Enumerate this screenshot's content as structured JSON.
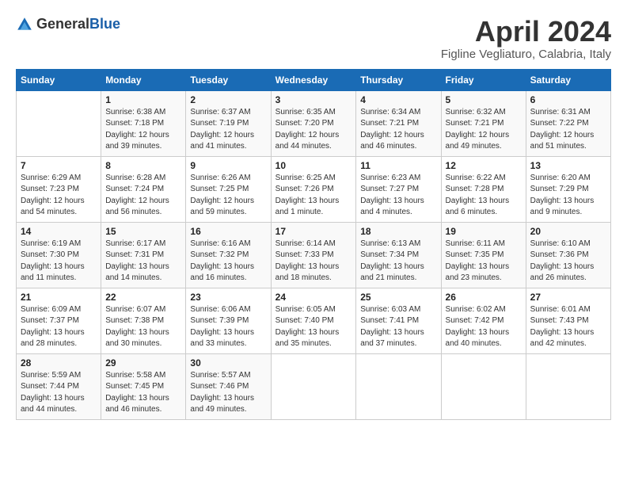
{
  "header": {
    "logo_general": "General",
    "logo_blue": "Blue",
    "title": "April 2024",
    "location": "Figline Vegliaturo, Calabria, Italy"
  },
  "columns": [
    "Sunday",
    "Monday",
    "Tuesday",
    "Wednesday",
    "Thursday",
    "Friday",
    "Saturday"
  ],
  "weeks": [
    [
      {
        "num": "",
        "detail": ""
      },
      {
        "num": "1",
        "detail": "Sunrise: 6:38 AM\nSunset: 7:18 PM\nDaylight: 12 hours\nand 39 minutes."
      },
      {
        "num": "2",
        "detail": "Sunrise: 6:37 AM\nSunset: 7:19 PM\nDaylight: 12 hours\nand 41 minutes."
      },
      {
        "num": "3",
        "detail": "Sunrise: 6:35 AM\nSunset: 7:20 PM\nDaylight: 12 hours\nand 44 minutes."
      },
      {
        "num": "4",
        "detail": "Sunrise: 6:34 AM\nSunset: 7:21 PM\nDaylight: 12 hours\nand 46 minutes."
      },
      {
        "num": "5",
        "detail": "Sunrise: 6:32 AM\nSunset: 7:21 PM\nDaylight: 12 hours\nand 49 minutes."
      },
      {
        "num": "6",
        "detail": "Sunrise: 6:31 AM\nSunset: 7:22 PM\nDaylight: 12 hours\nand 51 minutes."
      }
    ],
    [
      {
        "num": "7",
        "detail": "Sunrise: 6:29 AM\nSunset: 7:23 PM\nDaylight: 12 hours\nand 54 minutes."
      },
      {
        "num": "8",
        "detail": "Sunrise: 6:28 AM\nSunset: 7:24 PM\nDaylight: 12 hours\nand 56 minutes."
      },
      {
        "num": "9",
        "detail": "Sunrise: 6:26 AM\nSunset: 7:25 PM\nDaylight: 12 hours\nand 59 minutes."
      },
      {
        "num": "10",
        "detail": "Sunrise: 6:25 AM\nSunset: 7:26 PM\nDaylight: 13 hours\nand 1 minute."
      },
      {
        "num": "11",
        "detail": "Sunrise: 6:23 AM\nSunset: 7:27 PM\nDaylight: 13 hours\nand 4 minutes."
      },
      {
        "num": "12",
        "detail": "Sunrise: 6:22 AM\nSunset: 7:28 PM\nDaylight: 13 hours\nand 6 minutes."
      },
      {
        "num": "13",
        "detail": "Sunrise: 6:20 AM\nSunset: 7:29 PM\nDaylight: 13 hours\nand 9 minutes."
      }
    ],
    [
      {
        "num": "14",
        "detail": "Sunrise: 6:19 AM\nSunset: 7:30 PM\nDaylight: 13 hours\nand 11 minutes."
      },
      {
        "num": "15",
        "detail": "Sunrise: 6:17 AM\nSunset: 7:31 PM\nDaylight: 13 hours\nand 14 minutes."
      },
      {
        "num": "16",
        "detail": "Sunrise: 6:16 AM\nSunset: 7:32 PM\nDaylight: 13 hours\nand 16 minutes."
      },
      {
        "num": "17",
        "detail": "Sunrise: 6:14 AM\nSunset: 7:33 PM\nDaylight: 13 hours\nand 18 minutes."
      },
      {
        "num": "18",
        "detail": "Sunrise: 6:13 AM\nSunset: 7:34 PM\nDaylight: 13 hours\nand 21 minutes."
      },
      {
        "num": "19",
        "detail": "Sunrise: 6:11 AM\nSunset: 7:35 PM\nDaylight: 13 hours\nand 23 minutes."
      },
      {
        "num": "20",
        "detail": "Sunrise: 6:10 AM\nSunset: 7:36 PM\nDaylight: 13 hours\nand 26 minutes."
      }
    ],
    [
      {
        "num": "21",
        "detail": "Sunrise: 6:09 AM\nSunset: 7:37 PM\nDaylight: 13 hours\nand 28 minutes."
      },
      {
        "num": "22",
        "detail": "Sunrise: 6:07 AM\nSunset: 7:38 PM\nDaylight: 13 hours\nand 30 minutes."
      },
      {
        "num": "23",
        "detail": "Sunrise: 6:06 AM\nSunset: 7:39 PM\nDaylight: 13 hours\nand 33 minutes."
      },
      {
        "num": "24",
        "detail": "Sunrise: 6:05 AM\nSunset: 7:40 PM\nDaylight: 13 hours\nand 35 minutes."
      },
      {
        "num": "25",
        "detail": "Sunrise: 6:03 AM\nSunset: 7:41 PM\nDaylight: 13 hours\nand 37 minutes."
      },
      {
        "num": "26",
        "detail": "Sunrise: 6:02 AM\nSunset: 7:42 PM\nDaylight: 13 hours\nand 40 minutes."
      },
      {
        "num": "27",
        "detail": "Sunrise: 6:01 AM\nSunset: 7:43 PM\nDaylight: 13 hours\nand 42 minutes."
      }
    ],
    [
      {
        "num": "28",
        "detail": "Sunrise: 5:59 AM\nSunset: 7:44 PM\nDaylight: 13 hours\nand 44 minutes."
      },
      {
        "num": "29",
        "detail": "Sunrise: 5:58 AM\nSunset: 7:45 PM\nDaylight: 13 hours\nand 46 minutes."
      },
      {
        "num": "30",
        "detail": "Sunrise: 5:57 AM\nSunset: 7:46 PM\nDaylight: 13 hours\nand 49 minutes."
      },
      {
        "num": "",
        "detail": ""
      },
      {
        "num": "",
        "detail": ""
      },
      {
        "num": "",
        "detail": ""
      },
      {
        "num": "",
        "detail": ""
      }
    ]
  ]
}
